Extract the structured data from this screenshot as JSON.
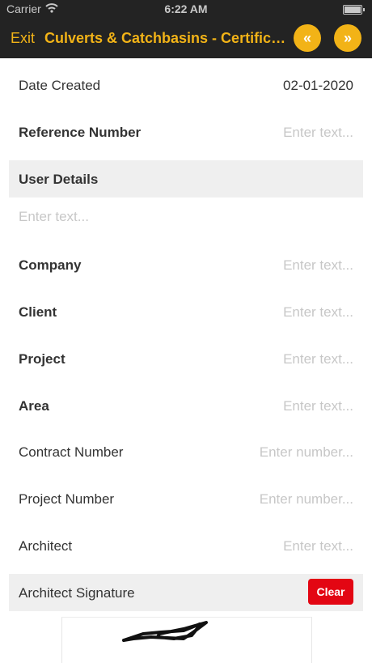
{
  "status_bar": {
    "carrier": "Carrier",
    "time": "6:22 AM"
  },
  "nav": {
    "exit_label": "Exit",
    "title": "Culverts & Catchbasins - Certificate",
    "prev_glyph": "«",
    "next_glyph": "»"
  },
  "form": {
    "date_created": {
      "label": "Date Created",
      "value": "02-01-2020"
    },
    "reference_number": {
      "label": "Reference Number",
      "placeholder": "Enter text..."
    },
    "user_details": {
      "section_label": "User Details",
      "placeholder": "Enter text..."
    },
    "company": {
      "label": "Company",
      "placeholder": "Enter text..."
    },
    "client": {
      "label": "Client",
      "placeholder": "Enter text..."
    },
    "project": {
      "label": "Project",
      "placeholder": "Enter text..."
    },
    "area": {
      "label": "Area",
      "placeholder": "Enter text..."
    },
    "contract_number": {
      "label": "Contract Number",
      "placeholder": "Enter number..."
    },
    "project_number": {
      "label": "Project Number",
      "placeholder": "Enter number..."
    },
    "architect": {
      "label": "Architect",
      "placeholder": "Enter text..."
    },
    "architect_signature": {
      "label": "Architect Signature",
      "clear_label": "Clear"
    }
  },
  "colors": {
    "accent": "#f2b317",
    "bar": "#232323",
    "danger": "#e30613",
    "placeholder": "#c7c7c7",
    "section_bg": "#efefef"
  }
}
